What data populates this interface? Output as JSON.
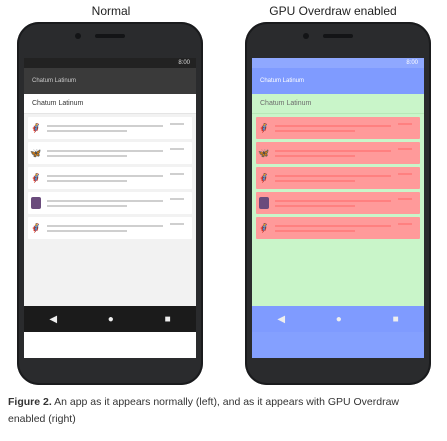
{
  "titles": {
    "left": "Normal",
    "right": "GPU Overdraw enabled"
  },
  "status_time": "8:00",
  "appbar_label": "Chatum Latinum",
  "content_title": "Chatum Latinum",
  "avatars_left": [
    "🦸",
    "🦋",
    "🦸",
    "🟪",
    "🦸"
  ],
  "avatars_right": [
    "🦸",
    "🦋",
    "🦸",
    "🟪",
    "🦸"
  ],
  "nav": {
    "back": "◀",
    "home": "●",
    "recents": "■"
  },
  "caption": {
    "label": "Figure 2.",
    "text": "An app as it appears normally (left), and as it appears with GPU Overdraw enabled (right)"
  },
  "colors": {
    "overdraw_blue": "#84a0ff",
    "overdraw_green": "#c9f5c9",
    "overdraw_red": "#ff9a9a",
    "avatar_purple": "#6a4b7c"
  }
}
